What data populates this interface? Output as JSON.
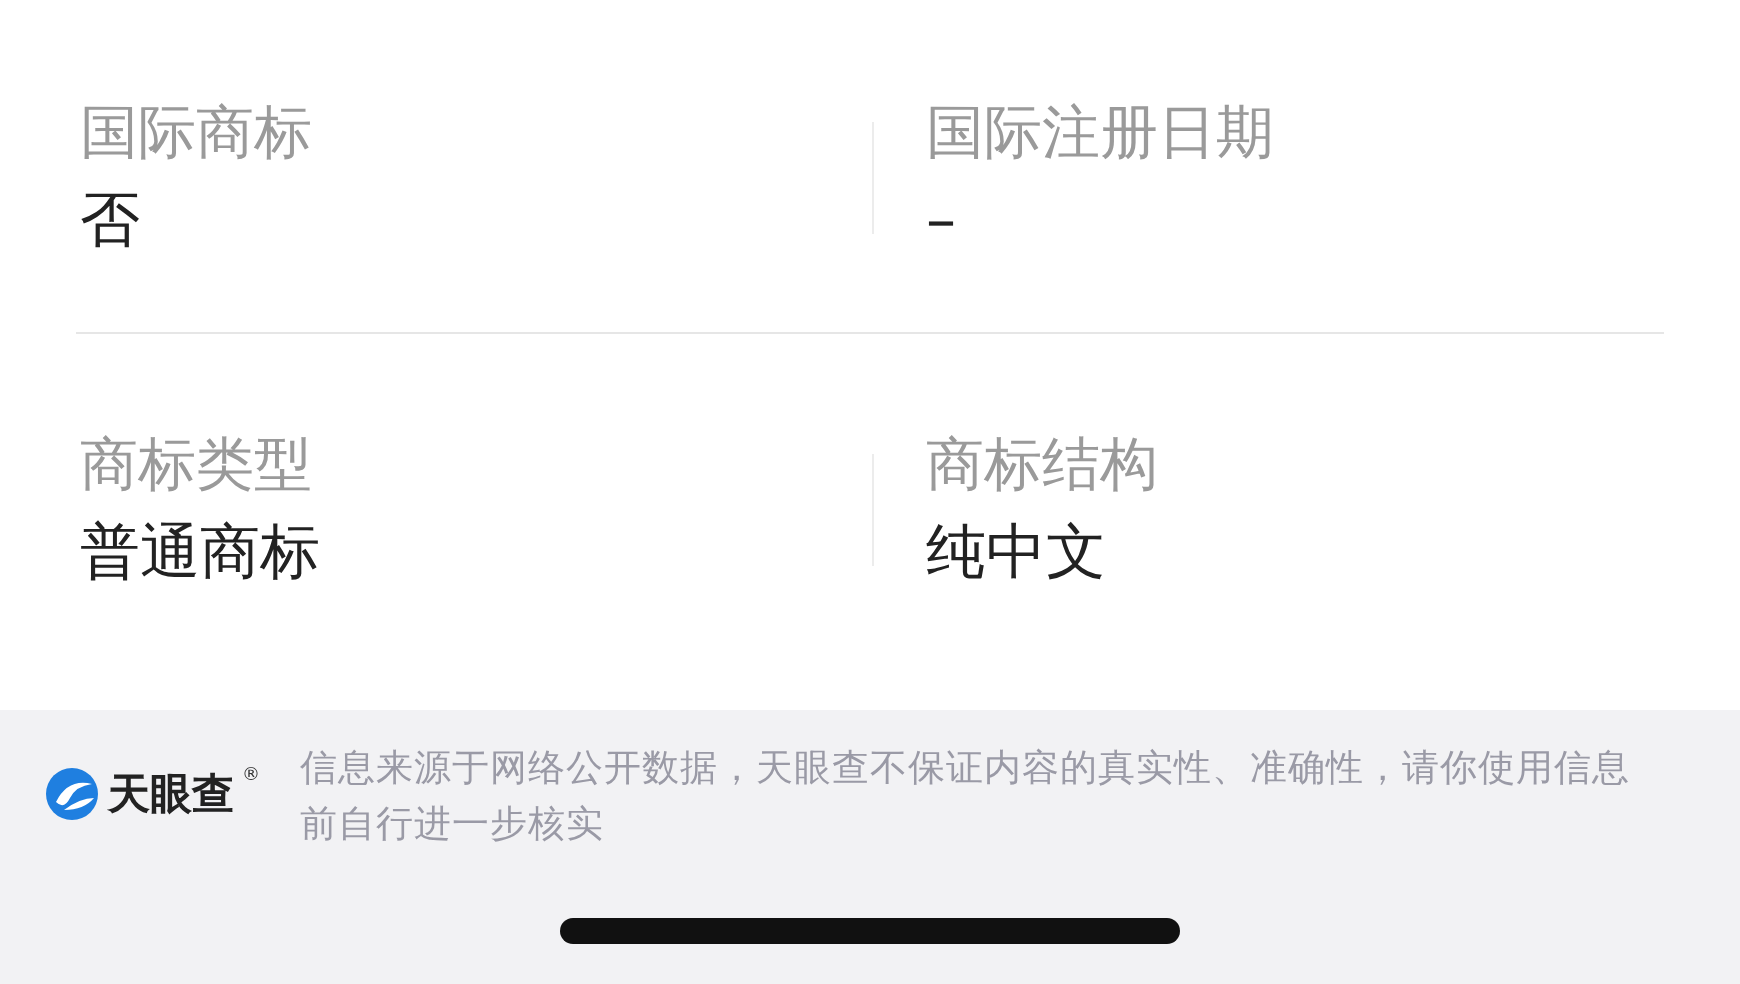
{
  "fields": [
    {
      "label": "国际商标",
      "value": "否"
    },
    {
      "label": "国际注册日期",
      "value": "–"
    },
    {
      "label": "商标类型",
      "value": "普通商标"
    },
    {
      "label": "商标结构",
      "value": "纯中文"
    }
  ],
  "footer": {
    "logo": {
      "name": "天眼查",
      "mark": "®"
    },
    "disclaimer": "信息来源于网络公开数据，天眼查不保证内容的真实性、准确性，请你使用信息前自行进一步核实"
  }
}
